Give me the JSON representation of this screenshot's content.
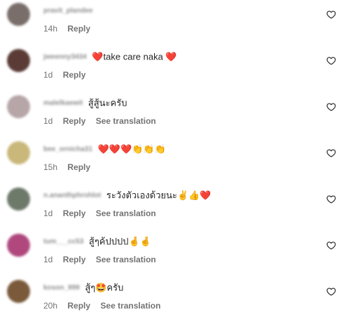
{
  "comments": [
    {
      "username": "pravit_plandee",
      "text": "",
      "time": "14h",
      "reply": "Reply",
      "translate": "",
      "avatar_color": "#7a6e6a"
    },
    {
      "username": "jweenny3434",
      "text": "❤️take care naka ❤️",
      "time": "1d",
      "reply": "Reply",
      "translate": "",
      "avatar_color": "#5a3b35"
    },
    {
      "username": "malelkaewit",
      "text": "สู้สู้นะครับ",
      "time": "1d",
      "reply": "Reply",
      "translate": "See translation",
      "avatar_color": "#b6a6a8"
    },
    {
      "username": "bee_ornicha31",
      "text": "❤️❤️❤️👏👏👏",
      "time": "15h",
      "reply": "Reply",
      "translate": "",
      "avatar_color": "#c9b87a"
    },
    {
      "username": "n.ananthphrohlot",
      "text": "ระวังตัวเองด้วยนะ✌️👍❤️",
      "time": "1d",
      "reply": "Reply",
      "translate": "See translation",
      "avatar_color": "#6d7a6a"
    },
    {
      "username": "tum___cc53",
      "text": "สู้ๆค้ปปปป🤞🤞",
      "time": "1d",
      "reply": "Reply",
      "translate": "See translation",
      "avatar_color": "#b0487e"
    },
    {
      "username": "koson_999",
      "text": "สู้ๆ🤩ครับ",
      "time": "20h",
      "reply": "Reply",
      "translate": "See translation",
      "avatar_color": "#7a5a3a"
    }
  ],
  "icons": {
    "like": "heart-outline-icon"
  }
}
